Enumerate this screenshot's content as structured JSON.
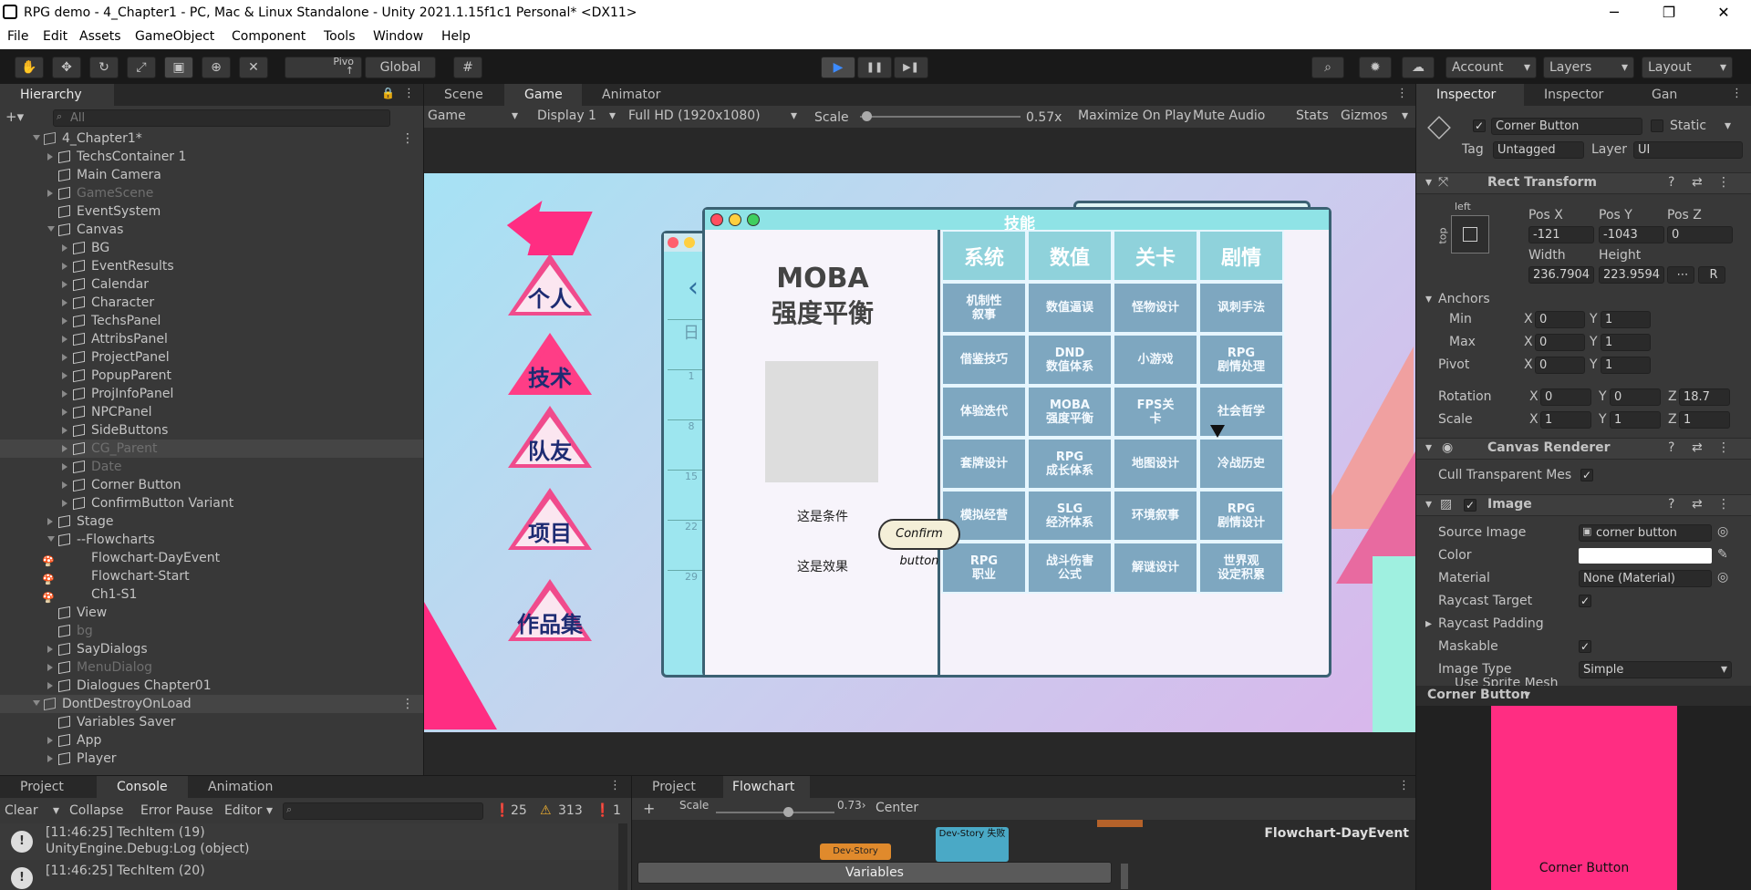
{
  "window": {
    "title": "RPG demo - 4_Chapter1 - PC, Mac & Linux Standalone - Unity 2021.1.15f1c1 Personal* <DX11>",
    "min": "─",
    "max": "❐",
    "close": "✕"
  },
  "menu": [
    "File",
    "Edit",
    "Assets",
    "GameObject",
    "Component",
    "Tools",
    "Window",
    "Help"
  ],
  "toolbar": {
    "pivot": "Pivo\n↑",
    "global": "Global",
    "account": "Account",
    "layers": "Layers",
    "layout": "Layout",
    "play": "▶",
    "pause": "❚❚",
    "step": "▶❚"
  },
  "hierarchy": {
    "tab": "Hierarchy",
    "search": "All",
    "items": [
      {
        "label": "4_Chapter1*",
        "depth": 0,
        "kind": "scene",
        "open": true
      },
      {
        "label": "TechsContainer 1",
        "depth": 1,
        "kind": "go",
        "arrow": "right"
      },
      {
        "label": "Main Camera",
        "depth": 1,
        "kind": "go",
        "arrow": "none"
      },
      {
        "label": "GameScene",
        "depth": 1,
        "kind": "go",
        "arrow": "right",
        "dim": true
      },
      {
        "label": "EventSystem",
        "depth": 1,
        "kind": "go",
        "arrow": "none"
      },
      {
        "label": "Canvas",
        "depth": 1,
        "kind": "go",
        "arrow": "down"
      },
      {
        "label": "BG",
        "depth": 2,
        "kind": "go",
        "arrow": "right"
      },
      {
        "label": "EventResults",
        "depth": 2,
        "kind": "go",
        "arrow": "right"
      },
      {
        "label": "Calendar",
        "depth": 2,
        "kind": "go",
        "arrow": "right"
      },
      {
        "label": "Character",
        "depth": 2,
        "kind": "go",
        "arrow": "right"
      },
      {
        "label": "TechsPanel",
        "depth": 2,
        "kind": "go",
        "arrow": "right"
      },
      {
        "label": "AttribsPanel",
        "depth": 2,
        "kind": "go",
        "arrow": "right"
      },
      {
        "label": "ProjectPanel",
        "depth": 2,
        "kind": "go",
        "arrow": "right"
      },
      {
        "label": "PopupParent",
        "depth": 2,
        "kind": "go",
        "arrow": "right"
      },
      {
        "label": "ProjInfoPanel",
        "depth": 2,
        "kind": "go",
        "arrow": "right"
      },
      {
        "label": "NPCPanel",
        "depth": 2,
        "kind": "go",
        "arrow": "right"
      },
      {
        "label": "SideButtons",
        "depth": 2,
        "kind": "go",
        "arrow": "right"
      },
      {
        "label": "CG_Parent",
        "depth": 2,
        "kind": "go",
        "arrow": "right",
        "dim": true,
        "sel": true
      },
      {
        "label": "Date",
        "depth": 2,
        "kind": "go",
        "arrow": "right",
        "dim": true
      },
      {
        "label": "Corner Button",
        "depth": 2,
        "kind": "go",
        "arrow": "right"
      },
      {
        "label": "ConfirmButton Variant",
        "depth": 2,
        "kind": "go",
        "arrow": "right"
      },
      {
        "label": "Stage",
        "depth": 1,
        "kind": "go",
        "arrow": "right"
      },
      {
        "label": "--Flowcharts",
        "depth": 1,
        "kind": "go",
        "arrow": "down"
      },
      {
        "label": "Flowchart-DayEvent",
        "depth": 2,
        "kind": "fc",
        "arrow": "none"
      },
      {
        "label": "Flowchart-Start",
        "depth": 2,
        "kind": "fc",
        "arrow": "none"
      },
      {
        "label": "Ch1-S1",
        "depth": 2,
        "kind": "fc",
        "arrow": "none"
      },
      {
        "label": "View",
        "depth": 1,
        "kind": "go",
        "arrow": "none"
      },
      {
        "label": "bg",
        "depth": 1,
        "kind": "go",
        "arrow": "none",
        "dim": true
      },
      {
        "label": "SayDialogs",
        "depth": 1,
        "kind": "go",
        "arrow": "right"
      },
      {
        "label": "MenuDialog",
        "depth": 1,
        "kind": "go",
        "arrow": "right",
        "dim": true
      },
      {
        "label": "Dialogues Chapter01",
        "depth": 1,
        "kind": "go",
        "arrow": "right"
      },
      {
        "label": "DontDestroyOnLoad",
        "depth": 0,
        "kind": "scene",
        "open": true,
        "sel": true
      },
      {
        "label": "Variables Saver",
        "depth": 1,
        "kind": "go",
        "arrow": "none"
      },
      {
        "label": "App",
        "depth": 1,
        "kind": "go",
        "arrow": "right"
      },
      {
        "label": "Player",
        "depth": 1,
        "kind": "go",
        "arrow": "right"
      }
    ]
  },
  "sceneview": {
    "tabs": [
      "Scene",
      "Game",
      "Animator"
    ],
    "game_dropdown": "Game",
    "display": "Display 1",
    "resolution": "Full HD (1920x1080)",
    "scale_label": "Scale",
    "scale_value": "0.57x",
    "maximize": "Maximize On Play",
    "mute": "Mute Audio",
    "stats": "Stats",
    "gizmos": "Gizmos"
  },
  "game": {
    "window_title": "技能",
    "card_title_1": "MOBA",
    "card_title_2": "强度平衡",
    "condition": "这是条件",
    "effect": "这是效果",
    "confirm": "Confirm button",
    "side": [
      "个人",
      "技术",
      "队友",
      "项目",
      "作品集"
    ],
    "headers": [
      "系统",
      "数值",
      "关卡",
      "剧情"
    ],
    "cells": [
      [
        "机制性\n叙事",
        "数值逼误",
        "怪物设计",
        "讽刺手法"
      ],
      [
        "借鉴技巧",
        "DND\n数值体系",
        "小游戏",
        "RPG\n剧情处理"
      ],
      [
        "体验迭代",
        "MOBA\n强度平衡",
        "FPS关\n卡",
        "社会哲学"
      ],
      [
        "套牌设计",
        "RPG\n成长体系",
        "地图设计",
        "冷战历史"
      ],
      [
        "模拟经营",
        "SLG\n经济体系",
        "环境叙事",
        "RPG\n剧情设计"
      ],
      [
        "RPG\n职业",
        "战斗伤害\n公式",
        "解谜设计",
        "世界观\n设定积累"
      ]
    ],
    "calendar": [
      "日",
      "1",
      "8",
      "15",
      "22",
      "29"
    ]
  },
  "inspector": {
    "tabs": [
      "Inspector",
      "Inspector",
      "Gan"
    ],
    "name": "Corner Button",
    "static": "Static",
    "tag_label": "Tag",
    "tag": "Untagged",
    "layer_label": "Layer",
    "layer": "UI",
    "rect": {
      "title": "Rect Transform",
      "anchor_h": "left",
      "anchor_v": "top",
      "posx_l": "Pos X",
      "posy_l": "Pos Y",
      "posz_l": "Pos Z",
      "posx": "-121",
      "posy": "-1043",
      "posz": "0",
      "w_l": "Width",
      "h_l": "Height",
      "w": "236.7904",
      "h": "223.9594",
      "r": "R",
      "anchors": "Anchors",
      "min": "Min",
      "max": "Max",
      "pivot": "Pivot",
      "rotation": "Rotation",
      "scale": "Scale",
      "min_x": "0",
      "min_y": "1",
      "max_x": "0",
      "max_y": "1",
      "piv_x": "0",
      "piv_y": "1",
      "rot_x": "0",
      "rot_y": "0",
      "rot_z": "18.7",
      "sc_x": "1",
      "sc_y": "1",
      "sc_z": "1"
    },
    "canvas_renderer": {
      "title": "Canvas Renderer",
      "cull": "Cull Transparent Mes"
    },
    "image": {
      "title": "Image",
      "source_l": "Source Image",
      "source": "corner button",
      "color_l": "Color",
      "material_l": "Material",
      "material": "None (Material)",
      "raycast_l": "Raycast Target",
      "padding_l": "Raycast Padding",
      "maskable_l": "Maskable",
      "type_l": "Image Type",
      "type": "Simple",
      "sprite_mesh": "Use Sprite Mesh"
    },
    "preview_title": "Corner Button",
    "preview_label": "Corner Button",
    "preview_color": "#ff2d82"
  },
  "console": {
    "tabs": [
      "Project",
      "Console",
      "Animation"
    ],
    "clear": "Clear",
    "collapse": "Collapse",
    "errorpause": "Error Pause",
    "editor": "Editor",
    "count_info": "25",
    "count_warn": "313",
    "count_err": "1",
    "logs": [
      {
        "l1": "[11:46:25] TechItem (19)",
        "l2": "UnityEngine.Debug:Log (object)"
      },
      {
        "l1": "[11:46:25] TechItem (20)",
        "l2": ""
      }
    ]
  },
  "flowchart": {
    "tabs": [
      "Project",
      "Flowchart"
    ],
    "scale_l": "Scale",
    "scale": "0.73›",
    "center": "Center",
    "variables": "Variables",
    "name": "Flowchart-DayEvent",
    "node1": "Dev-Story",
    "node2": "Dev-Story 失败"
  }
}
